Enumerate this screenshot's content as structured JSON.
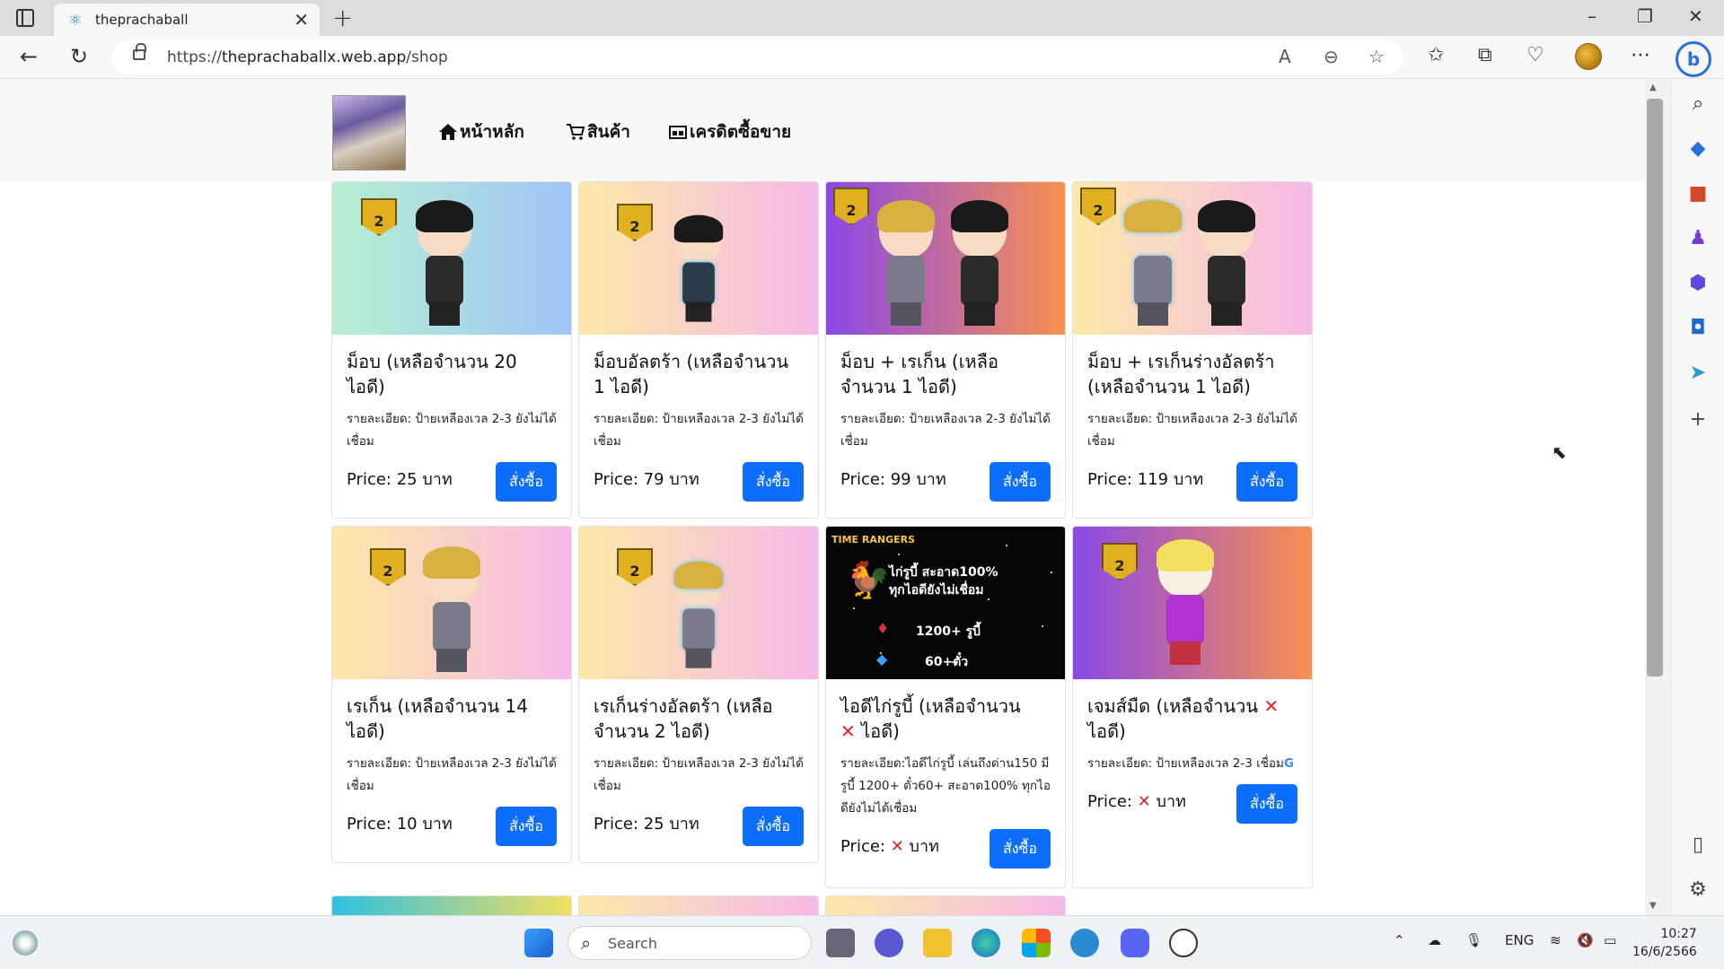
{
  "browser": {
    "tab_title": "theprachaball",
    "url_prefix": "https://",
    "url_host": "theprachaballx.web.app",
    "url_path": "/shop"
  },
  "nav": {
    "home": "หน้าหลัก",
    "products": "สินค้า",
    "credit": "เครดิตซื้อขาย"
  },
  "products": [
    {
      "title": "ม็อบ (เหลือจำนวน 20 ไอดี)",
      "desc": "รายละเอียด: ป้ายเหลืองเวล 2-3 ยังไม่ได้เชื่อม",
      "price_prefix": "Price:",
      "price_value": "25",
      "price_unit": "บาท",
      "buy_label": "สั่งซื้อ"
    },
    {
      "title": "ม็อบอัลตร้า (เหลือจำนวน 1 ไอดี)",
      "desc": "รายละเอียด: ป้ายเหลืองเวล 2-3 ยังไม่ได้เชื่อม",
      "price_prefix": "Price:",
      "price_value": "79",
      "price_unit": "บาท",
      "buy_label": "สั่งซื้อ"
    },
    {
      "title": "ม็อบ + เรเก็น (เหลือจำนวน 1 ไอดี)",
      "desc": "รายละเอียด: ป้ายเหลืองเวล 2-3 ยังไม่ได้เชื่อม",
      "price_prefix": "Price:",
      "price_value": "99",
      "price_unit": "บาท",
      "buy_label": "สั่งซื้อ"
    },
    {
      "title": "ม็อบ + เรเก็นร่างอัลตร้า (เหลือจำนวน 1 ไอดี)",
      "desc": "รายละเอียด: ป้ายเหลืองเวล 2-3 ยังไม่ได้เชื่อม",
      "price_prefix": "Price:",
      "price_value": "119",
      "price_unit": "บาท",
      "buy_label": "สั่งซื้อ"
    },
    {
      "title": "เรเก็น (เหลือจำนวน 14 ไอดี)",
      "desc": "รายละเอียด: ป้ายเหลืองเวล 2-3 ยังไม่ได้เชื่อม",
      "price_prefix": "Price:",
      "price_value": "10",
      "price_unit": "บาท",
      "buy_label": "สั่งซื้อ"
    },
    {
      "title": "เรเก็นร่างอัลตร้า (เหลือจำนวน 2 ไอดี)",
      "desc": "รายละเอียด: ป้ายเหลืองเวล 2-3 ยังไม่ได้เชื่อม",
      "price_prefix": "Price:",
      "price_value": "25",
      "price_unit": "บาท",
      "buy_label": "สั่งซื้อ"
    },
    {
      "title_a": "ไอดีไก่รูบี้ (เหลือจำนวน",
      "title_b": "ไอดี)",
      "desc": "รายละเอียด:ไอดีไก่รูบี้ เล่นถึงด่าน150 มีรูบี้ 1200+ ตั๋ว60+ สะอาด100% ทุกไอดียังไม่ได้เชื่อม",
      "price_prefix": "Price:",
      "price_unit": "บาท",
      "buy_label": "สั่งซื้อ"
    },
    {
      "title_a": "เจมส์มืด (เหลือจำนวน",
      "title_b": "ไอดี)",
      "desc": "รายละเอียด: ป้ายเหลืองเวล 2-3 เชื่อม",
      "price_prefix": "Price:",
      "price_unit": "บาท",
      "buy_label": "สั่งซื้อ"
    }
  ],
  "ad_image": {
    "brand": "TIME RANGERS",
    "line1": "ไก่รูบี้ สะอาด100%",
    "line2": "ทุกไอดียังไม่เชื่อม",
    "line3": "1200+ รูบี้",
    "line4": "60+ตั๋ว"
  },
  "taskbar": {
    "search_placeholder": "Search",
    "lang": "ENG",
    "time": "10:27",
    "date": "16/6/2566"
  }
}
